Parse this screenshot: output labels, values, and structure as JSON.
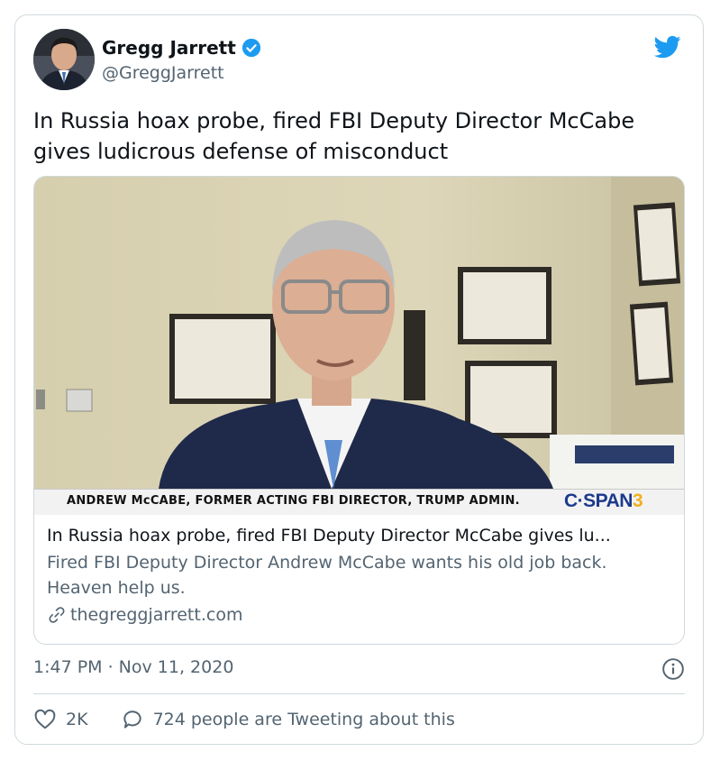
{
  "tweet": {
    "author": {
      "name": "Gregg Jarrett",
      "handle": "@GreggJarrett",
      "verified": true
    },
    "text": "In Russia hoax probe, fired FBI Deputy Director McCabe gives ludicrous defense of misconduct",
    "link_card": {
      "caption": "ANDREW McCABE, FORMER ACTING FBI DIRECTOR, TRUMP ADMIN.",
      "network_logo_text": "C·SPAN",
      "network_logo_number": "3",
      "title": "In Russia hoax probe, fired FBI Deputy Director McCabe gives lu...",
      "description": "Fired FBI Deputy Director Andrew McCabe wants his old job back. Heaven help us.",
      "domain": "thegreggjarrett.com"
    },
    "timestamp": "1:47 PM · Nov 11, 2020",
    "likes": "2K",
    "reply_text": "724 people are Tweeting about this"
  },
  "colors": {
    "accent": "#1d9bf0",
    "text": "#0f1419",
    "secondary": "#536471",
    "border": "#cfd9de"
  },
  "icons": [
    "verified-badge-icon",
    "twitter-bird-icon",
    "info-icon",
    "heart-icon",
    "reply-icon",
    "link-icon"
  ]
}
